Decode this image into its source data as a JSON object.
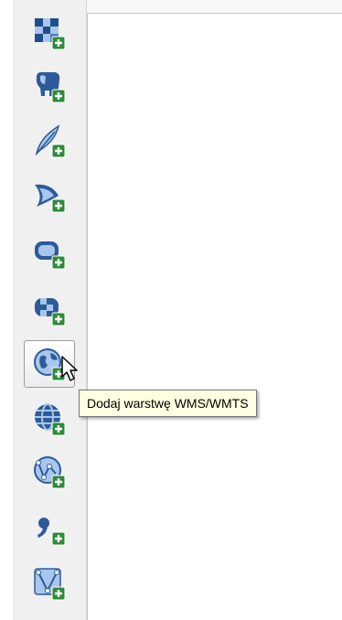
{
  "colors": {
    "icon_blue": "#2d5b9a",
    "icon_light": "#a9c6ec",
    "plus_green": "#2e8b3a",
    "tooltip_bg": "#ffffe1"
  },
  "toolbar": {
    "buttons": [
      {
        "name": "add-raster-layer",
        "icon": "raster-grid-icon"
      },
      {
        "name": "add-postgis-layer",
        "icon": "postgis-elephant-icon"
      },
      {
        "name": "add-spatialite-layer",
        "icon": "spatialite-feather-icon"
      },
      {
        "name": "add-mssql-layer",
        "icon": "mssql-sail-icon"
      },
      {
        "name": "add-oracle-layer",
        "icon": "oracle-rounded-icon"
      },
      {
        "name": "add-db2-layer",
        "icon": "db2-checker-icon"
      },
      {
        "name": "add-wms-wmts-layer",
        "icon": "wms-globe-icon",
        "hovered": true
      },
      {
        "name": "add-wcs-layer",
        "icon": "wcs-globe-icon"
      },
      {
        "name": "add-wfs-layer",
        "icon": "wfs-globe-icon"
      },
      {
        "name": "add-delimited-text-layer",
        "icon": "comma-icon"
      },
      {
        "name": "add-virtual-layer",
        "icon": "virtual-layer-icon"
      }
    ]
  },
  "tooltip": {
    "text": "Dodaj warstwę WMS/WMTS"
  }
}
